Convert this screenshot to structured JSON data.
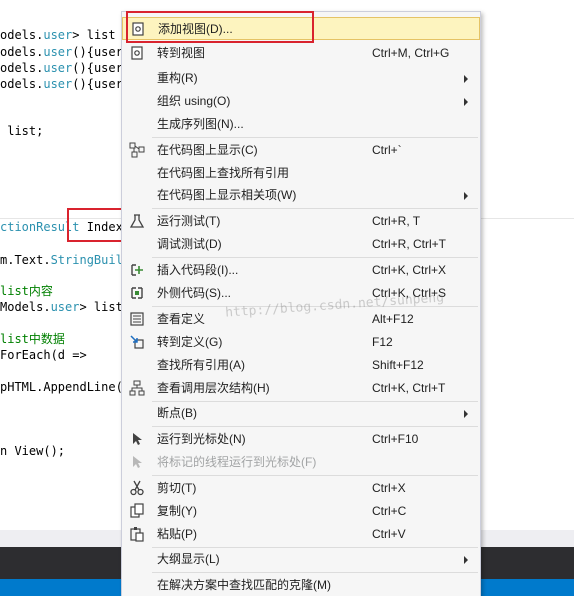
{
  "editor": {
    "lines": [
      {
        "segments": [
          {
            "text": "odels.",
            "cls": ""
          },
          {
            "text": "user",
            "cls": "kw"
          },
          {
            "text": "> list =",
            "cls": ""
          }
        ]
      },
      {
        "segments": [
          {
            "text": "odels.",
            "cls": ""
          },
          {
            "text": "user",
            "cls": "kw"
          },
          {
            "text": "(){userN",
            "cls": ""
          }
        ]
      },
      {
        "segments": [
          {
            "text": "odels.",
            "cls": ""
          },
          {
            "text": "user",
            "cls": "kw"
          },
          {
            "text": "(){userN",
            "cls": ""
          }
        ]
      },
      {
        "segments": [
          {
            "text": "odels.",
            "cls": ""
          },
          {
            "text": "user",
            "cls": "kw"
          },
          {
            "text": "(){userN",
            "cls": ""
          }
        ]
      },
      {
        "segments": [
          {
            "text": " list;",
            "cls": ""
          }
        ]
      },
      {
        "segments": [
          {
            "text": "ctionResult",
            "cls": "kw"
          },
          {
            "text": " Index()",
            "cls": ""
          }
        ]
      },
      {
        "segments": [
          {
            "text": "m.Text.",
            "cls": ""
          },
          {
            "text": "StringBuild",
            "cls": "kw"
          }
        ]
      },
      {
        "segments": [
          {
            "text": "list内容",
            "cls": "cm"
          }
        ]
      },
      {
        "segments": [
          {
            "text": "Models.",
            "cls": ""
          },
          {
            "text": "user",
            "cls": "kw"
          },
          {
            "text": "> list",
            "cls": ""
          }
        ]
      },
      {
        "segments": [
          {
            "text": "list中数据",
            "cls": "cm"
          }
        ]
      },
      {
        "segments": [
          {
            "text": "ForEach(d =>",
            "cls": ""
          }
        ]
      },
      {
        "segments": [
          {
            "text": "pHTML.AppendLine(\"",
            "cls": ""
          }
        ]
      },
      {
        "segments": [
          {
            "text": "n View();",
            "cls": ""
          }
        ]
      }
    ]
  },
  "watermark": "http://blog.csdn.net/sunpeng",
  "menu": {
    "items": [
      {
        "label": "添加视图(D)...",
        "shortcut": "",
        "icon": "add-view-icon",
        "submenu": false,
        "highlighted": true
      },
      {
        "label": "转到视图",
        "shortcut": "Ctrl+M, Ctrl+G",
        "icon": "go-to-view-icon",
        "submenu": false
      },
      {
        "label": "重构(R)",
        "shortcut": "",
        "icon": "",
        "submenu": true
      },
      {
        "label": "组织 using(O)",
        "shortcut": "",
        "icon": "",
        "submenu": true
      },
      {
        "label": "生成序列图(N)...",
        "shortcut": "",
        "icon": "",
        "submenu": false
      },
      {
        "label": "在代码图上显示(C)",
        "shortcut": "Ctrl+`",
        "icon": "code-map-icon",
        "submenu": false
      },
      {
        "label": "在代码图上查找所有引用",
        "shortcut": "",
        "icon": "",
        "submenu": false
      },
      {
        "label": "在代码图上显示相关项(W)",
        "shortcut": "",
        "icon": "",
        "submenu": true
      },
      {
        "label": "运行测试(T)",
        "shortcut": "Ctrl+R, T",
        "icon": "run-tests-icon",
        "submenu": false
      },
      {
        "label": "调试测试(D)",
        "shortcut": "Ctrl+R, Ctrl+T",
        "icon": "",
        "submenu": false
      },
      {
        "label": "插入代码段(I)...",
        "shortcut": "Ctrl+K, Ctrl+X",
        "icon": "insert-snippet-icon",
        "submenu": false
      },
      {
        "label": "外侧代码(S)...",
        "shortcut": "Ctrl+K, Ctrl+S",
        "icon": "surround-with-icon",
        "submenu": false
      },
      {
        "label": "查看定义",
        "shortcut": "Alt+F12",
        "icon": "peek-definition-icon",
        "submenu": false
      },
      {
        "label": "转到定义(G)",
        "shortcut": "F12",
        "icon": "go-to-definition-icon",
        "submenu": false
      },
      {
        "label": "查找所有引用(A)",
        "shortcut": "Shift+F12",
        "icon": "",
        "submenu": false
      },
      {
        "label": "查看调用层次结构(H)",
        "shortcut": "Ctrl+K, Ctrl+T",
        "icon": "call-hierarchy-icon",
        "submenu": false
      },
      {
        "label": "断点(B)",
        "shortcut": "",
        "icon": "",
        "submenu": true
      },
      {
        "label": "运行到光标处(N)",
        "shortcut": "Ctrl+F10",
        "icon": "run-to-cursor-icon",
        "submenu": false
      },
      {
        "label": "将标记的线程运行到光标处(F)",
        "shortcut": "",
        "icon": "run-flagged-threads-icon",
        "submenu": false,
        "disabled": true
      },
      {
        "label": "剪切(T)",
        "shortcut": "Ctrl+X",
        "icon": "cut-icon",
        "submenu": false
      },
      {
        "label": "复制(Y)",
        "shortcut": "Ctrl+C",
        "icon": "copy-icon",
        "submenu": false
      },
      {
        "label": "粘贴(P)",
        "shortcut": "Ctrl+V",
        "icon": "paste-icon",
        "submenu": false
      },
      {
        "label": "大纲显示(L)",
        "shortcut": "",
        "icon": "",
        "submenu": true
      },
      {
        "label": "在解决方案中查找匹配的克隆(M)",
        "shortcut": "",
        "icon": "",
        "submenu": false
      }
    ]
  }
}
